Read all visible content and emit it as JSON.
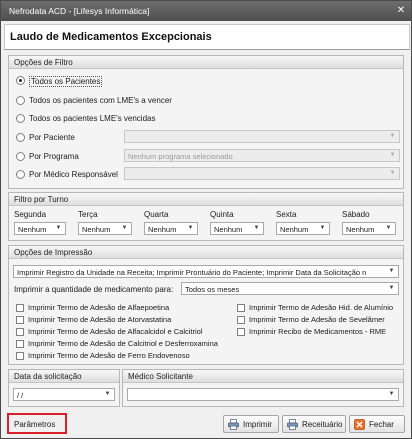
{
  "window": {
    "title": "Nefrodata ACD - [Lifesys Informática]",
    "close_glyph": "✕"
  },
  "header": {
    "title": "Laudo de Medicamentos Excepcionais"
  },
  "filter": {
    "title": "Opções de Filtro",
    "options": [
      {
        "label": "Todos os Pacientes",
        "selected": true
      },
      {
        "label": "Todos os pacientes com LME's a vencer",
        "selected": false
      },
      {
        "label": "Todos os pacientes LME's vencidas",
        "selected": false
      },
      {
        "label": "Por Paciente",
        "selected": false
      },
      {
        "label": "Por Programa",
        "selected": false
      },
      {
        "label": "Por Médico Responsável",
        "selected": false
      }
    ],
    "paciente_value": "",
    "programa_value": "Nenhum programa selecionado",
    "medico_value": ""
  },
  "turno": {
    "title": "Filtro por Turno",
    "days": [
      {
        "label": "Segunda",
        "value": "Nenhum"
      },
      {
        "label": "Terça",
        "value": "Nenhum"
      },
      {
        "label": "Quarta",
        "value": "Nenhum"
      },
      {
        "label": "Quinta",
        "value": "Nenhum"
      },
      {
        "label": "Sexta",
        "value": "Nenhum"
      },
      {
        "label": "Sábado",
        "value": "Nenhum"
      }
    ]
  },
  "impressao": {
    "title": "Opções de Impressão",
    "registro_value": "Imprimir Registro da Unidade na Receita; Imprimir Prontuário do Paciente; Imprimir Data da Solicitação n",
    "quantidade_label": "Imprimir a quantidade de medicamento para:",
    "quantidade_value": "Todos os meses",
    "checks_left": [
      "Imprimir Termo de Adesão de Alfaepoetina",
      "Imprimir Termo de Adesão de Atorvastatina",
      "Imprimir Termo de Adesão de Alfacalcidol e Calcitriol",
      "Imprimir Termo de Adesão de Calcitriol e Desferroxamina",
      "Imprimir Termo de Adesão de Ferro Endovenoso"
    ],
    "checks_right": [
      "Imprimir Termo de Adesão Hid. de Alumínio",
      "Imprimir Termo de Adesão de Sevelâmer",
      "Imprimir Recibo de Medicamentos - RME"
    ]
  },
  "data_solicitacao": {
    "title": "Data da solicitação",
    "value": " / /"
  },
  "medico_solicitante": {
    "title": "Médico Solicitante",
    "value": ""
  },
  "footer": {
    "parametros_label": "Parâmetros",
    "imprimir_label": "Imprimir",
    "receituario_label": "Receituário",
    "fechar_label": "Fechar"
  },
  "colors": {
    "highlight_border": "#d9202a",
    "titlebar": "#5a5a5a"
  }
}
